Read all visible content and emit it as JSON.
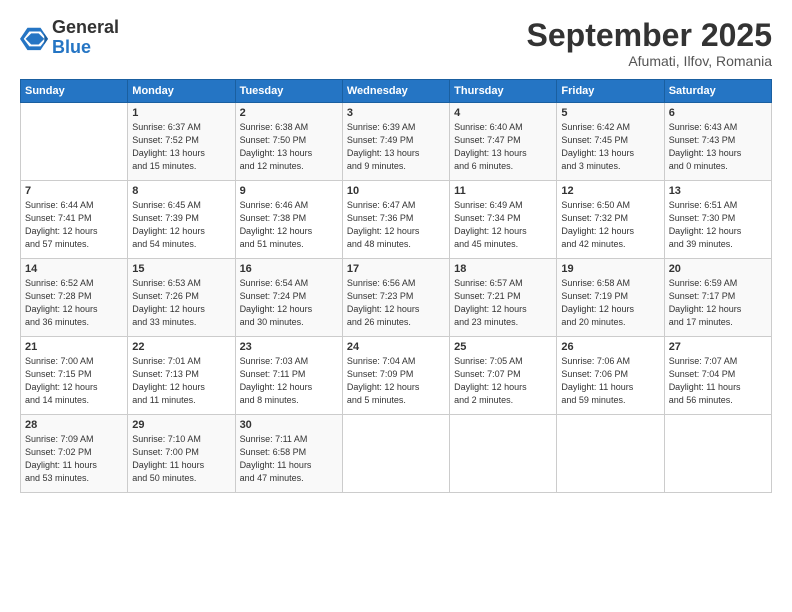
{
  "header": {
    "logo_general": "General",
    "logo_blue": "Blue",
    "month_year": "September 2025",
    "location": "Afumati, Ilfov, Romania"
  },
  "days_of_week": [
    "Sunday",
    "Monday",
    "Tuesday",
    "Wednesday",
    "Thursday",
    "Friday",
    "Saturday"
  ],
  "weeks": [
    [
      {
        "day": "",
        "info": ""
      },
      {
        "day": "1",
        "info": "Sunrise: 6:37 AM\nSunset: 7:52 PM\nDaylight: 13 hours\nand 15 minutes."
      },
      {
        "day": "2",
        "info": "Sunrise: 6:38 AM\nSunset: 7:50 PM\nDaylight: 13 hours\nand 12 minutes."
      },
      {
        "day": "3",
        "info": "Sunrise: 6:39 AM\nSunset: 7:49 PM\nDaylight: 13 hours\nand 9 minutes."
      },
      {
        "day": "4",
        "info": "Sunrise: 6:40 AM\nSunset: 7:47 PM\nDaylight: 13 hours\nand 6 minutes."
      },
      {
        "day": "5",
        "info": "Sunrise: 6:42 AM\nSunset: 7:45 PM\nDaylight: 13 hours\nand 3 minutes."
      },
      {
        "day": "6",
        "info": "Sunrise: 6:43 AM\nSunset: 7:43 PM\nDaylight: 13 hours\nand 0 minutes."
      }
    ],
    [
      {
        "day": "7",
        "info": "Sunrise: 6:44 AM\nSunset: 7:41 PM\nDaylight: 12 hours\nand 57 minutes."
      },
      {
        "day": "8",
        "info": "Sunrise: 6:45 AM\nSunset: 7:39 PM\nDaylight: 12 hours\nand 54 minutes."
      },
      {
        "day": "9",
        "info": "Sunrise: 6:46 AM\nSunset: 7:38 PM\nDaylight: 12 hours\nand 51 minutes."
      },
      {
        "day": "10",
        "info": "Sunrise: 6:47 AM\nSunset: 7:36 PM\nDaylight: 12 hours\nand 48 minutes."
      },
      {
        "day": "11",
        "info": "Sunrise: 6:49 AM\nSunset: 7:34 PM\nDaylight: 12 hours\nand 45 minutes."
      },
      {
        "day": "12",
        "info": "Sunrise: 6:50 AM\nSunset: 7:32 PM\nDaylight: 12 hours\nand 42 minutes."
      },
      {
        "day": "13",
        "info": "Sunrise: 6:51 AM\nSunset: 7:30 PM\nDaylight: 12 hours\nand 39 minutes."
      }
    ],
    [
      {
        "day": "14",
        "info": "Sunrise: 6:52 AM\nSunset: 7:28 PM\nDaylight: 12 hours\nand 36 minutes."
      },
      {
        "day": "15",
        "info": "Sunrise: 6:53 AM\nSunset: 7:26 PM\nDaylight: 12 hours\nand 33 minutes."
      },
      {
        "day": "16",
        "info": "Sunrise: 6:54 AM\nSunset: 7:24 PM\nDaylight: 12 hours\nand 30 minutes."
      },
      {
        "day": "17",
        "info": "Sunrise: 6:56 AM\nSunset: 7:23 PM\nDaylight: 12 hours\nand 26 minutes."
      },
      {
        "day": "18",
        "info": "Sunrise: 6:57 AM\nSunset: 7:21 PM\nDaylight: 12 hours\nand 23 minutes."
      },
      {
        "day": "19",
        "info": "Sunrise: 6:58 AM\nSunset: 7:19 PM\nDaylight: 12 hours\nand 20 minutes."
      },
      {
        "day": "20",
        "info": "Sunrise: 6:59 AM\nSunset: 7:17 PM\nDaylight: 12 hours\nand 17 minutes."
      }
    ],
    [
      {
        "day": "21",
        "info": "Sunrise: 7:00 AM\nSunset: 7:15 PM\nDaylight: 12 hours\nand 14 minutes."
      },
      {
        "day": "22",
        "info": "Sunrise: 7:01 AM\nSunset: 7:13 PM\nDaylight: 12 hours\nand 11 minutes."
      },
      {
        "day": "23",
        "info": "Sunrise: 7:03 AM\nSunset: 7:11 PM\nDaylight: 12 hours\nand 8 minutes."
      },
      {
        "day": "24",
        "info": "Sunrise: 7:04 AM\nSunset: 7:09 PM\nDaylight: 12 hours\nand 5 minutes."
      },
      {
        "day": "25",
        "info": "Sunrise: 7:05 AM\nSunset: 7:07 PM\nDaylight: 12 hours\nand 2 minutes."
      },
      {
        "day": "26",
        "info": "Sunrise: 7:06 AM\nSunset: 7:06 PM\nDaylight: 11 hours\nand 59 minutes."
      },
      {
        "day": "27",
        "info": "Sunrise: 7:07 AM\nSunset: 7:04 PM\nDaylight: 11 hours\nand 56 minutes."
      }
    ],
    [
      {
        "day": "28",
        "info": "Sunrise: 7:09 AM\nSunset: 7:02 PM\nDaylight: 11 hours\nand 53 minutes."
      },
      {
        "day": "29",
        "info": "Sunrise: 7:10 AM\nSunset: 7:00 PM\nDaylight: 11 hours\nand 50 minutes."
      },
      {
        "day": "30",
        "info": "Sunrise: 7:11 AM\nSunset: 6:58 PM\nDaylight: 11 hours\nand 47 minutes."
      },
      {
        "day": "",
        "info": ""
      },
      {
        "day": "",
        "info": ""
      },
      {
        "day": "",
        "info": ""
      },
      {
        "day": "",
        "info": ""
      }
    ]
  ]
}
